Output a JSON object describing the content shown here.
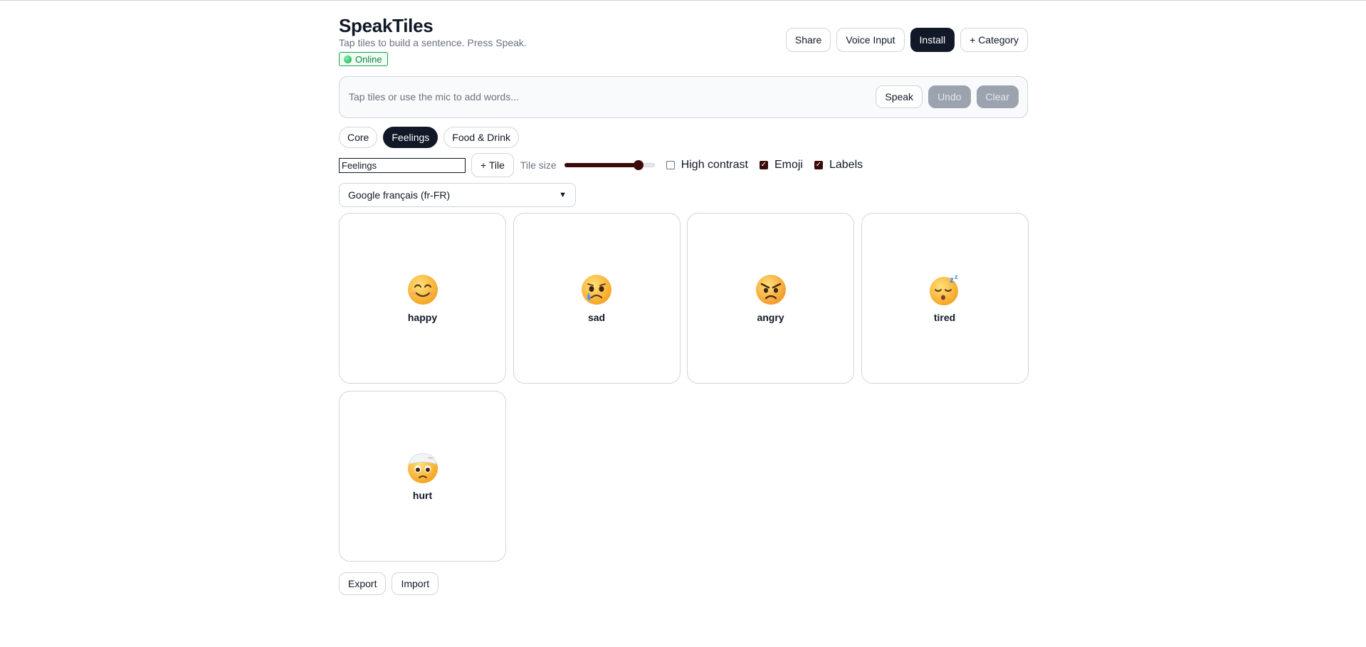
{
  "app": {
    "title": "SpeakTiles",
    "subtitle": "Tap tiles to build a sentence. Press Speak.",
    "status": "Online",
    "status_color": "#16a34a"
  },
  "header_actions": {
    "share": "Share",
    "voice_input": "Voice Input",
    "install": "Install",
    "add_category": "+ Category"
  },
  "sentence": {
    "placeholder": "Tap tiles or use the mic to add words...",
    "speak": "Speak",
    "undo": "Undo",
    "clear": "Clear"
  },
  "categories": [
    {
      "label": "Core",
      "active": false
    },
    {
      "label": "Feelings",
      "active": true
    },
    {
      "label": "Food & Drink",
      "active": false
    }
  ],
  "controls": {
    "category_name_value": "Feelings",
    "add_tile": "+ Tile",
    "tile_size_label": "Tile size",
    "tile_size_fraction": 0.82,
    "high_contrast_label": "High contrast",
    "high_contrast_checked": false,
    "emoji_label": "Emoji",
    "emoji_checked": true,
    "labels_label": "Labels",
    "labels_checked": true
  },
  "voice": {
    "selected": "Google français (fr-FR)"
  },
  "tiles": [
    {
      "label": "happy",
      "icon": "smiling-face-icon"
    },
    {
      "label": "sad",
      "icon": "crying-face-icon"
    },
    {
      "label": "angry",
      "icon": "angry-face-icon"
    },
    {
      "label": "tired",
      "icon": "sleeping-face-icon"
    },
    {
      "label": "hurt",
      "icon": "bandaged-head-face-icon"
    }
  ],
  "footer": {
    "export": "Export",
    "import": "Import"
  },
  "colors": {
    "accent_dark": "#111827",
    "disabled": "#9ca3af",
    "slider": "#3b0a0a"
  }
}
